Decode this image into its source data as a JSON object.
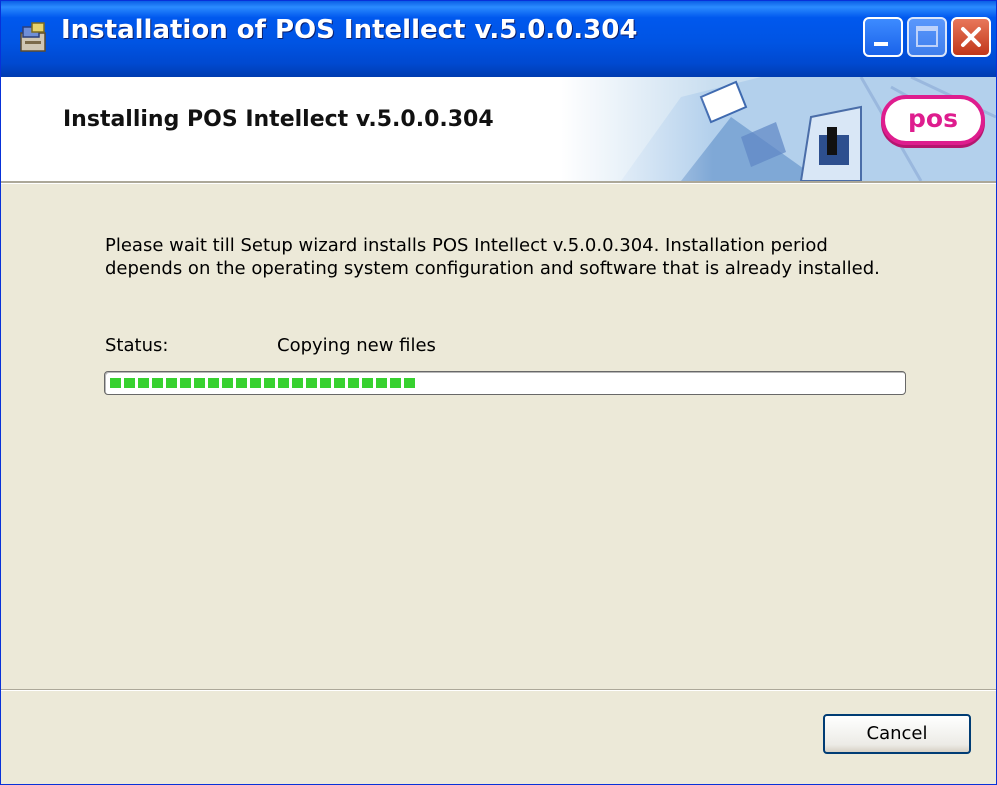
{
  "window": {
    "title": "Installation of POS Intellect v.5.0.0.304"
  },
  "header": {
    "title": "Installing POS Intellect v.5.0.0.304",
    "logo_text": "pos"
  },
  "body": {
    "description": "Please wait till Setup wizard installs POS Intellect v.5.0.0.304. Installation period depends on the operating system configuration and software that is already installed.",
    "status_label": "Status:",
    "status_value": "Copying new files",
    "progress_fraction": 0.39
  },
  "footer": {
    "cancel_label": "Cancel"
  },
  "colors": {
    "titlebar": "#0054e3",
    "progress": "#37d12f",
    "logo": "#de1d8e",
    "dialog_bg": "#ece9d8"
  },
  "icons": {
    "title_icon": "installer-icon",
    "minimize": "minimize-icon",
    "maximize": "maximize-icon",
    "close": "close-icon"
  }
}
